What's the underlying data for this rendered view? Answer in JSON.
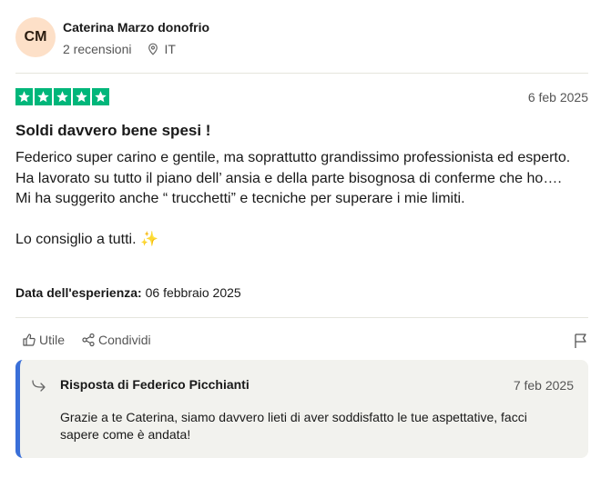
{
  "author": {
    "initials": "CM",
    "name": "Caterina Marzo donofrio",
    "reviews": "2 recensioni",
    "country": "IT"
  },
  "review": {
    "rating": 5,
    "date": "6 feb 2025",
    "title": "Soldi davvero bene spesi !",
    "body": "Federico super carino e gentile, ma soprattutto grandissimo professionista ed esperto.\nHa lavorato su tutto il piano dell’ ansia e della parte bisognosa di conferme che ho….\nMi ha suggerito anche “ trucchetti” e tecniche per superare i mie limiti.\n\nLo consiglio a tutti. ✨",
    "experience_label": "Data dell'esperienza:",
    "experience_date": "06 febbraio 2025"
  },
  "actions": {
    "useful": "Utile",
    "share": "Condividi"
  },
  "reply": {
    "title": "Risposta di Federico Picchianti",
    "date": "7 feb 2025",
    "text": "Grazie a te Caterina, siamo davvero lieti di aver soddisfatto le tue aspettative, facci sapere come è andata!"
  },
  "colors": {
    "star_green": "#00b67a",
    "reply_accent": "#3a6fd8",
    "avatar_bg": "#fde0c8"
  }
}
